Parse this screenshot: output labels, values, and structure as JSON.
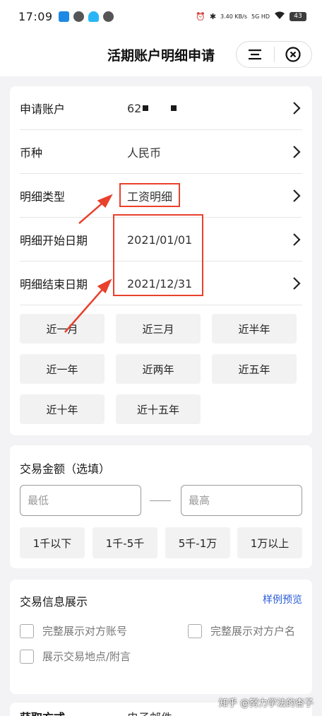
{
  "status_bar": {
    "time": "17:09",
    "net_speed": "3.40 KB/s",
    "network": "5G HD",
    "battery": "43",
    "app_icon_colors": [
      "#1e88e5",
      "#555555",
      "#29b6f6",
      "#555555"
    ]
  },
  "nav": {
    "title": "活期账户明细申请",
    "menu_icon": "menu-lines-icon",
    "close_icon": "close-circle-icon"
  },
  "detail_form": {
    "rows": [
      {
        "label": "申请账户",
        "value": "62"
      },
      {
        "label": "币种",
        "value": "人民币"
      },
      {
        "label": "明细类型",
        "value": "工资明细"
      },
      {
        "label": "明细开始日期",
        "value": "2021/01/01"
      },
      {
        "label": "明细结束日期",
        "value": "2021/12/31"
      }
    ],
    "quick_ranges": [
      "近一月",
      "近三月",
      "近半年",
      "近一年",
      "近两年",
      "近五年",
      "近十年",
      "近十五年"
    ]
  },
  "amount": {
    "title": "交易金额（选填）",
    "min_placeholder": "最低",
    "max_placeholder": "最高",
    "ranges": [
      "1千以下",
      "1千-5千",
      "5千-1万",
      "1万以上"
    ]
  },
  "display": {
    "title": "交易信息展示",
    "preview_link": "样例预览",
    "options": [
      "完整展示对方账号",
      "完整展示对方户名",
      "展示交易地点/附言"
    ]
  },
  "delivery": {
    "label": "获取方式",
    "value": "电子邮件"
  },
  "watermark": "知乎 @努力学法的杏子",
  "colors": {
    "highlight": "#e8412c",
    "link": "#2a5bd7",
    "chip_bg": "#f2f2f3",
    "page_bg": "#f3f3f5"
  }
}
